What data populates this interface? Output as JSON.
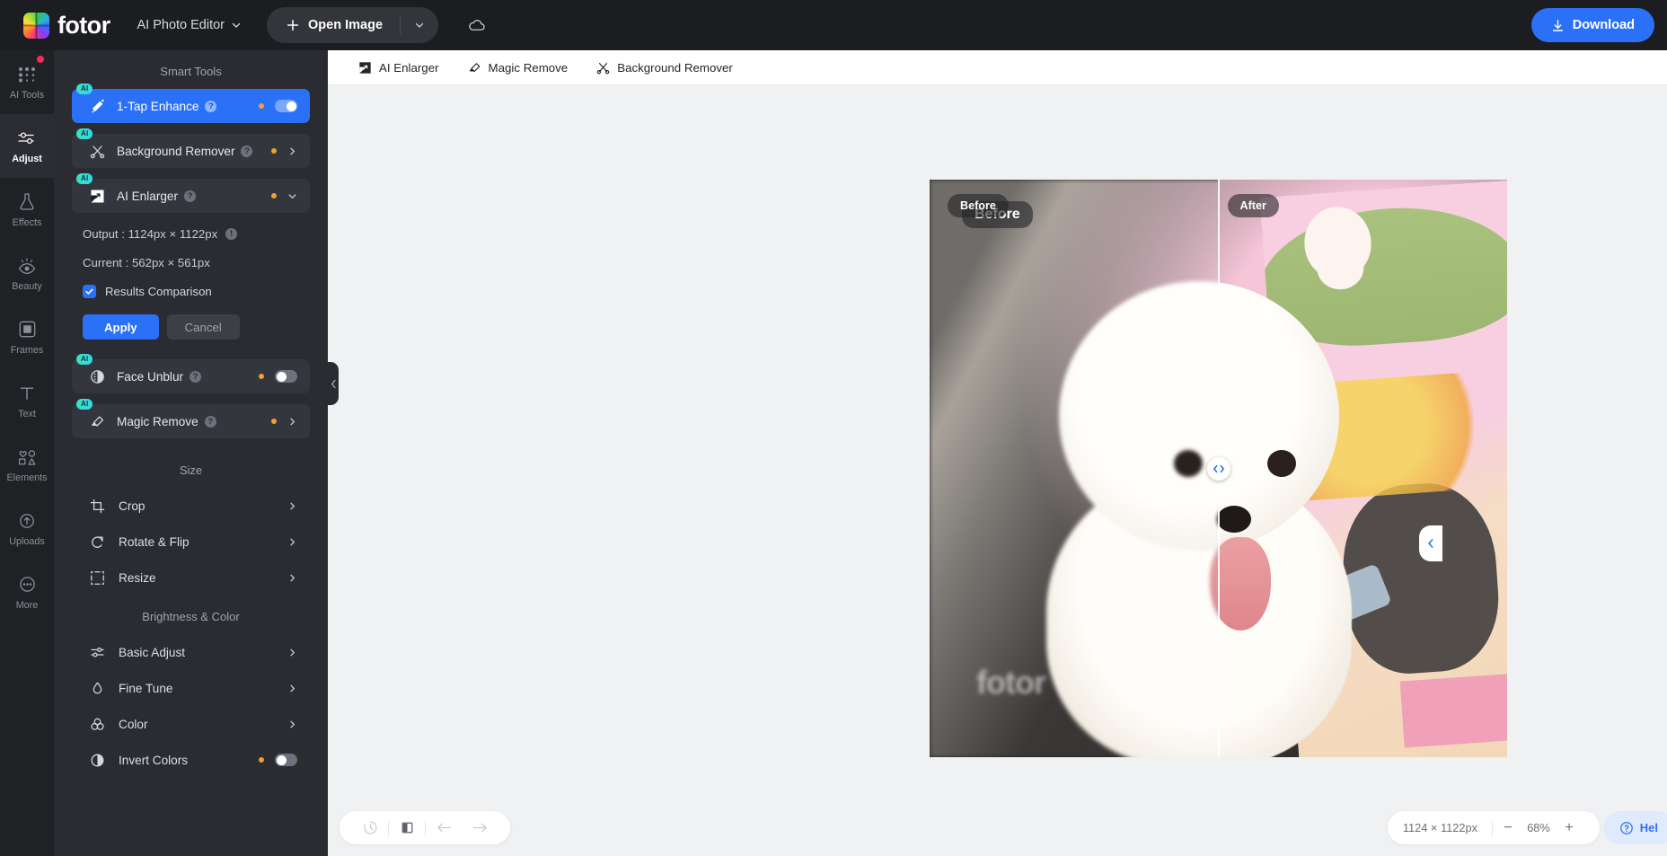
{
  "topbar": {
    "logo_text": "fotor",
    "app_selector": "AI Photo Editor",
    "open_image": "Open Image",
    "download": "Download"
  },
  "rail": {
    "items": [
      {
        "label": "AI Tools",
        "icon": "ai-tools-icon",
        "active": false,
        "badge": true
      },
      {
        "label": "Adjust",
        "icon": "adjust-icon",
        "active": true,
        "badge": false
      },
      {
        "label": "Effects",
        "icon": "effects-icon",
        "active": false,
        "badge": false
      },
      {
        "label": "Beauty",
        "icon": "beauty-icon",
        "active": false,
        "badge": false
      },
      {
        "label": "Frames",
        "icon": "frames-icon",
        "active": false,
        "badge": false
      },
      {
        "label": "Text",
        "icon": "text-icon",
        "active": false,
        "badge": false
      },
      {
        "label": "Elements",
        "icon": "elements-icon",
        "active": false,
        "badge": false
      },
      {
        "label": "Uploads",
        "icon": "uploads-icon",
        "active": false,
        "badge": false
      },
      {
        "label": "More",
        "icon": "more-icon",
        "active": false,
        "badge": false
      }
    ]
  },
  "panel": {
    "smart_tools_title": "Smart Tools",
    "ai_badge": "AI",
    "tools": [
      {
        "label": "1-Tap Enhance",
        "badge": "AI",
        "state": "toggle-on"
      },
      {
        "label": "Background Remover",
        "badge": "AI",
        "state": "chevron"
      },
      {
        "label": "AI Enlarger",
        "badge": "AI",
        "state": "chevron-down"
      }
    ],
    "enlarger": {
      "output_label": "Output : 1124px × 1122px",
      "current_label": "Current : 562px × 561px",
      "results_comparison": "Results Comparison",
      "apply": "Apply",
      "cancel": "Cancel"
    },
    "tools2": [
      {
        "label": "Face Unblur",
        "badge": "AI",
        "state": "toggle-off"
      },
      {
        "label": "Magic Remove",
        "badge": "AI",
        "state": "chevron"
      }
    ],
    "size_title": "Size",
    "size_items": [
      {
        "label": "Crop",
        "icon": "crop-icon"
      },
      {
        "label": "Rotate & Flip",
        "icon": "rotate-icon"
      },
      {
        "label": "Resize",
        "icon": "resize-icon"
      }
    ],
    "brightness_title": "Brightness & Color",
    "brightness_items": [
      {
        "label": "Basic Adjust",
        "icon": "sliders-icon",
        "state": "chevron"
      },
      {
        "label": "Fine Tune",
        "icon": "droplet-icon",
        "state": "chevron"
      },
      {
        "label": "Color",
        "icon": "color-circles-icon",
        "state": "chevron"
      },
      {
        "label": "Invert Colors",
        "icon": "invert-icon",
        "state": "toggle-off"
      }
    ]
  },
  "main_toolbar": {
    "items": [
      {
        "label": "AI Enlarger",
        "icon": "enlarge-icon"
      },
      {
        "label": "Magic Remove",
        "icon": "eraser-icon"
      },
      {
        "label": "Background Remover",
        "icon": "scissors-icon"
      }
    ]
  },
  "canvas": {
    "before_label": "Before",
    "before_label_secondary": "Before",
    "after_label": "After",
    "watermark": "fotor"
  },
  "bottombar": {
    "history_icon": "history-icon",
    "compare_icon": "compare-icon",
    "undo_icon": "undo-arrow-icon",
    "redo_icon": "redo-arrow-icon",
    "dimensions": "1124 × 1122px",
    "zoom_out": "−",
    "zoom_value": "68%",
    "zoom_in": "+",
    "help_label": "Hel"
  },
  "colors": {
    "accent_blue": "#2a71f8",
    "panel_bg": "#2a2c31",
    "rail_bg": "#202125",
    "topbar_bg": "#1c1d21",
    "ai_badge": "#3be0c0",
    "notify_dot": "#f6295b",
    "orange_dot": "#f0a02e"
  }
}
